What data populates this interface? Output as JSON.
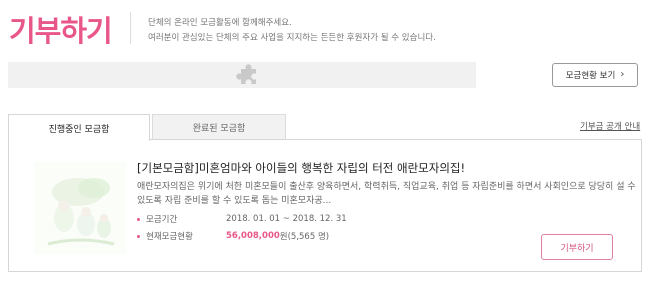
{
  "header": {
    "title": "기부하기",
    "desc_line1": "단체의 온라인 모금활동에 함께해주세요.",
    "desc_line2": "여러분이 관심있는 단체의 주요 사업을 지지하는 든든한 후원자가 될 수 있습니다."
  },
  "banner": {
    "icon": "puzzle-icon"
  },
  "status_button": {
    "label": "모금현황 보기",
    "icon": "chevron-right-icon"
  },
  "tabs": [
    {
      "label": "진행중인 모금함",
      "active": true
    },
    {
      "label": "완료된 모금함",
      "active": false
    }
  ],
  "disclosure_link": "기부금 공개 안내",
  "campaign": {
    "title": "[기본모금함]미혼엄마와 아이들의 행복한 자립의 터전 애란모자의집!",
    "description": "애란모자의집은 위기에 처한 미혼모들이 출산후 양육하면서, 학력취득, 직업교육, 취업 등 자립준비를 하면서 사회인으로 당당히 설 수 있도록 자립 준비를 할 수 있도록 돕는 미혼모자공...",
    "period_label": "모금기간",
    "period_value": "2018. 01. 01 ~ 2018. 12. 31",
    "status_label": "현재모금현황",
    "amount": "56,008,000",
    "amount_suffix": "원(5,565 명)",
    "donate_label": "기부하기"
  },
  "colors": {
    "accent": "#e8568a"
  }
}
